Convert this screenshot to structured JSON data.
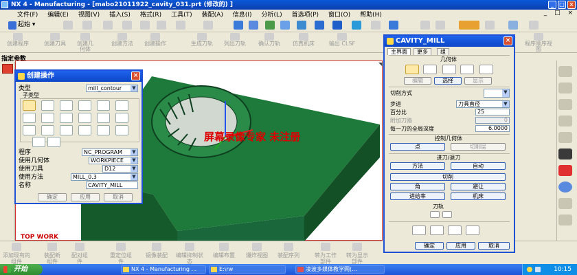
{
  "window": {
    "title": "NX 4 - Manufacturing - [mabo21011922_cavity_031.prt  (修改的) ]"
  },
  "menu": [
    "文件(F)",
    "编辑(E)",
    "视图(V)",
    "插入(S)",
    "格式(R)",
    "工具(T)",
    "装配(A)",
    "信息(I)",
    "分析(L)",
    "首选项(P)",
    "窗口(O)",
    "帮助(H)"
  ],
  "toolbar1": {
    "start_label": "起始 ▾"
  },
  "toolbar2": {
    "items": [
      "创建程序",
      "创建刀具",
      "创建几何体",
      "创建方法",
      "创建操作",
      "生成刀轨",
      "列出刀轨",
      "确认刀轨",
      "仿真机床",
      "输出 CLSF"
    ],
    "right_item": "程序顺序视图"
  },
  "nav": {
    "label": "指定参数"
  },
  "viewport": {
    "label": "TOP WORK",
    "watermark": "屏幕录像专家  未注册",
    "colors": {
      "part": "#1e7a3a",
      "part_dark": "#155a2a",
      "border": "#cc3333"
    }
  },
  "create_operation": {
    "title": "创建操作",
    "type_label": "类型",
    "type_value": "mill_contour",
    "subtype_label": "子类型",
    "program_label": "程序",
    "program_value": "NC_PROGRAM",
    "geometry_label": "使用几何体",
    "geometry_value": "WORKPIECE",
    "tool_label": "使用刀具",
    "tool_value": "D12",
    "method_label": "使用方法",
    "method_value": "MILL_0.3",
    "name_label": "名称",
    "name_value": "CAVITY_MILL",
    "buttons": [
      "确定",
      "应用",
      "取消"
    ]
  },
  "cavity_mill": {
    "title": "CAVITY_MILL",
    "tabs": [
      "主界面",
      "更多",
      "组"
    ],
    "geometry_header": "几何体",
    "geo_buttons": [
      "编辑",
      "选择",
      "显示"
    ],
    "cut_pattern_label": "切削方式",
    "stepover_label": "步进",
    "stepover_value": "刀具直径",
    "percent_label": "百分比",
    "percent_value": "25",
    "extra_passes_label": "附加刀路",
    "extra_passes_value": "0",
    "depth_label": "每一刀的全局深度",
    "depth_value": "6.0000",
    "control_geometry_header": "控制几何体",
    "control_buttons": [
      "点",
      "切削层"
    ],
    "engage_header": "进刀/退刀",
    "engage_buttons": [
      "方法",
      "自动"
    ],
    "cutting_button": "切削",
    "corner_button": "角",
    "avoid_button": "避让",
    "feed_button": "进给率",
    "machine_button": "机床",
    "toolpath_header": "刀轨",
    "buttons": [
      "确定",
      "应用",
      "取消"
    ]
  },
  "bottombar": {
    "items": [
      "添加现有的组件",
      "装配新组件",
      "配对组件",
      "重定位组件",
      "镜像装配",
      "编辑抑制状态",
      "编辑布置",
      "爆炸视图",
      "装配序列",
      "转为工作部件",
      "转为显示部件"
    ]
  },
  "taskbar": {
    "start": "开始",
    "tasks": [
      "NX 4 - Manufacturing ...",
      "E:\\rw",
      "凌波多媒体教学网(..."
    ],
    "clock": "10:15"
  }
}
